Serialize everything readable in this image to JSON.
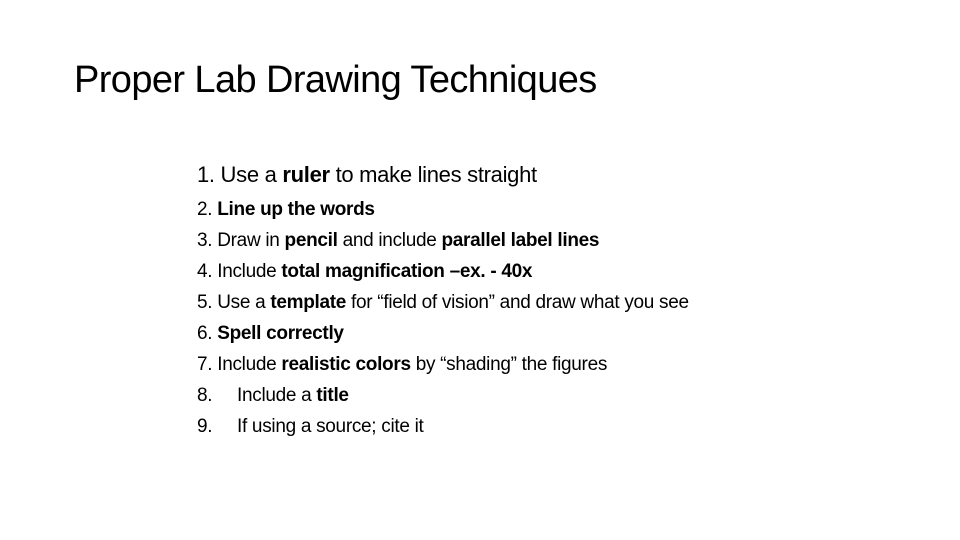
{
  "slide": {
    "title": "Proper Lab Drawing Techniques",
    "items": [
      {
        "num": "1.",
        "parts": [
          {
            "t": " Use a ",
            "b": false
          },
          {
            "t": "ruler",
            "b": true
          },
          {
            "t": " to make lines straight",
            "b": false
          }
        ]
      },
      {
        "num": "2.",
        "parts": [
          {
            "t": " ",
            "b": false
          },
          {
            "t": "Line up the words",
            "b": true
          }
        ]
      },
      {
        "num": "3.",
        "parts": [
          {
            "t": " Draw in ",
            "b": false
          },
          {
            "t": "pencil",
            "b": true
          },
          {
            "t": " and include ",
            "b": false
          },
          {
            "t": "parallel label lines",
            "b": true
          }
        ]
      },
      {
        "num": "4.",
        "parts": [
          {
            "t": " Include ",
            "b": false
          },
          {
            "t": "total magnification –ex. - 40x",
            "b": true
          }
        ]
      },
      {
        "num": "5.",
        "parts": [
          {
            "t": " Use a ",
            "b": false
          },
          {
            "t": "template",
            "b": true
          },
          {
            "t": " for “field of vision” and draw what you see",
            "b": false
          }
        ]
      },
      {
        "num": "6.",
        "parts": [
          {
            "t": " ",
            "b": false
          },
          {
            "t": "Spell correctly",
            "b": true
          }
        ]
      },
      {
        "num": "7.",
        "parts": [
          {
            "t": " Include ",
            "b": false
          },
          {
            "t": "realistic colors",
            "b": true
          },
          {
            "t": " by “shading” the figures",
            "b": false
          }
        ]
      },
      {
        "num": "8.",
        "parts": [
          {
            "t": "Include a ",
            "b": false
          },
          {
            "t": "title",
            "b": true
          }
        ]
      },
      {
        "num": "9.",
        "parts": [
          {
            "t": "If using a source; cite it",
            "b": false
          }
        ]
      }
    ]
  }
}
